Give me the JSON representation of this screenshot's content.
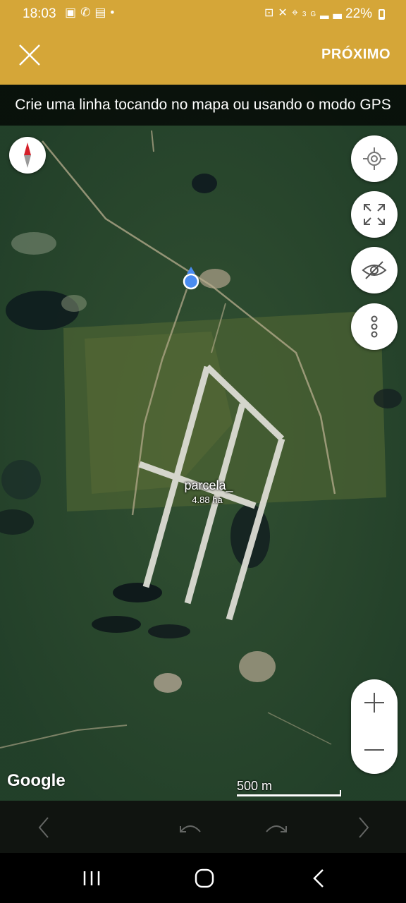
{
  "status_bar": {
    "time": "18:03",
    "left_icons": [
      "image-icon",
      "whatsapp-icon",
      "gallery-icon",
      "dot-icon"
    ],
    "right_icons": [
      "lock-icon",
      "mute-icon",
      "location-icon",
      "3g-icon",
      "signal-icon"
    ],
    "network": "3G",
    "battery_text": "22%",
    "battery_level": 22
  },
  "toolbar": {
    "close_icon": "close-icon",
    "next_label": "PRÓXIMO",
    "background": "#d5a638"
  },
  "map": {
    "instruction": "Crie uma linha tocando no mapa ou usando o modo GPS",
    "plot": {
      "name": "parcela_",
      "area": "4.88 ha"
    },
    "attribution": "Google",
    "scale_label": "500 m",
    "controls": [
      "my-location-icon",
      "fullscreen-icon",
      "visibility-off-icon",
      "more-vert-icon"
    ],
    "zoom": [
      "zoom-in-icon",
      "zoom-out-icon"
    ]
  },
  "bottom_toolbar": {
    "icons": [
      "chevron-left-icon",
      "undo-icon",
      "redo-icon",
      "chevron-right-icon"
    ]
  },
  "nav_bar": {
    "icons": [
      "recents-icon",
      "home-icon",
      "back-icon"
    ]
  }
}
